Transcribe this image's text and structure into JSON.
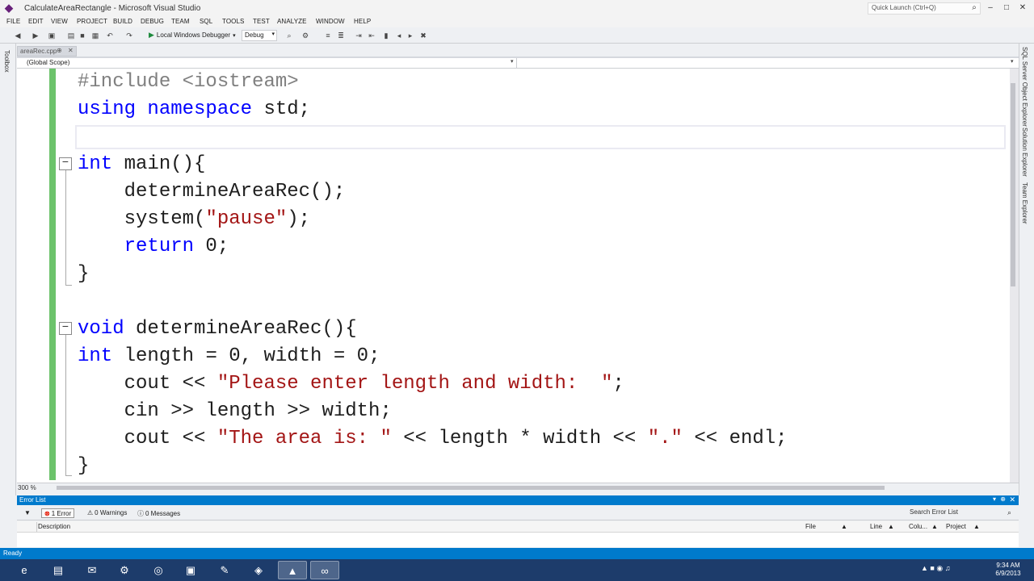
{
  "window": {
    "title": "CalculateAreaRectangle - Microsoft Visual Studio",
    "quick_launch_placeholder": "Quick Launch (Ctrl+Q)"
  },
  "menu": [
    "FILE",
    "EDIT",
    "VIEW",
    "PROJECT",
    "BUILD",
    "DEBUG",
    "TEAM",
    "SQL",
    "TOOLS",
    "TEST",
    "ANALYZE",
    "WINDOW",
    "HELP"
  ],
  "toolbar": {
    "debugger_label": "Local Windows Debugger",
    "configuration": "Debug"
  },
  "side_panels": {
    "left": "Toolbox",
    "right": [
      "SQL Server Object Explorer",
      "Solution Explorer",
      "Team Explorer"
    ]
  },
  "document": {
    "tab_label": "areaRec.cpp",
    "scope": "(Global Scope)",
    "zoom": "300 %"
  },
  "code_lines": [
    [
      {
        "t": "#include <iostream>",
        "c": "pp"
      }
    ],
    [
      {
        "t": "using",
        "c": "kw"
      },
      {
        "t": " ",
        "c": ""
      },
      {
        "t": "namespace",
        "c": "kw"
      },
      {
        "t": " std;",
        "c": ""
      }
    ],
    [
      {
        "t": "",
        "c": ""
      }
    ],
    [
      {
        "t": "int",
        "c": "kw"
      },
      {
        "t": " main(){",
        "c": ""
      }
    ],
    [
      {
        "t": "    determineAreaRec();",
        "c": ""
      }
    ],
    [
      {
        "t": "    system(",
        "c": ""
      },
      {
        "t": "\"pause\"",
        "c": "str"
      },
      {
        "t": ");",
        "c": ""
      }
    ],
    [
      {
        "t": "    ",
        "c": ""
      },
      {
        "t": "return",
        "c": "kw"
      },
      {
        "t": " 0;",
        "c": ""
      }
    ],
    [
      {
        "t": "}",
        "c": ""
      }
    ],
    [
      {
        "t": "",
        "c": ""
      }
    ],
    [
      {
        "t": "void",
        "c": "kw"
      },
      {
        "t": " determineAreaRec(){",
        "c": ""
      }
    ],
    [
      {
        "t": "int",
        "c": "kw"
      },
      {
        "t": " length = 0, width = 0;",
        "c": ""
      }
    ],
    [
      {
        "t": "    cout << ",
        "c": ""
      },
      {
        "t": "\"Please enter length and width:  \"",
        "c": "str"
      },
      {
        "t": ";",
        "c": ""
      }
    ],
    [
      {
        "t": "    cin >> length >> width;",
        "c": ""
      }
    ],
    [
      {
        "t": "    cout << ",
        "c": ""
      },
      {
        "t": "\"The area is: \"",
        "c": "str"
      },
      {
        "t": " << length * width << ",
        "c": ""
      },
      {
        "t": "\".\"",
        "c": "str"
      },
      {
        "t": " << endl;",
        "c": ""
      }
    ],
    [
      {
        "t": "}",
        "c": ""
      }
    ]
  ],
  "error_list": {
    "title": "Error List",
    "errors": "1 Error",
    "warnings": "0 Warnings",
    "messages": "0 Messages",
    "search_placeholder": "Search Error List",
    "columns": [
      "Description",
      "File",
      "Line",
      "Colu...",
      "Project"
    ]
  },
  "status": "Ready",
  "clock": {
    "time": "9:34 AM",
    "date": "6/9/2013"
  }
}
